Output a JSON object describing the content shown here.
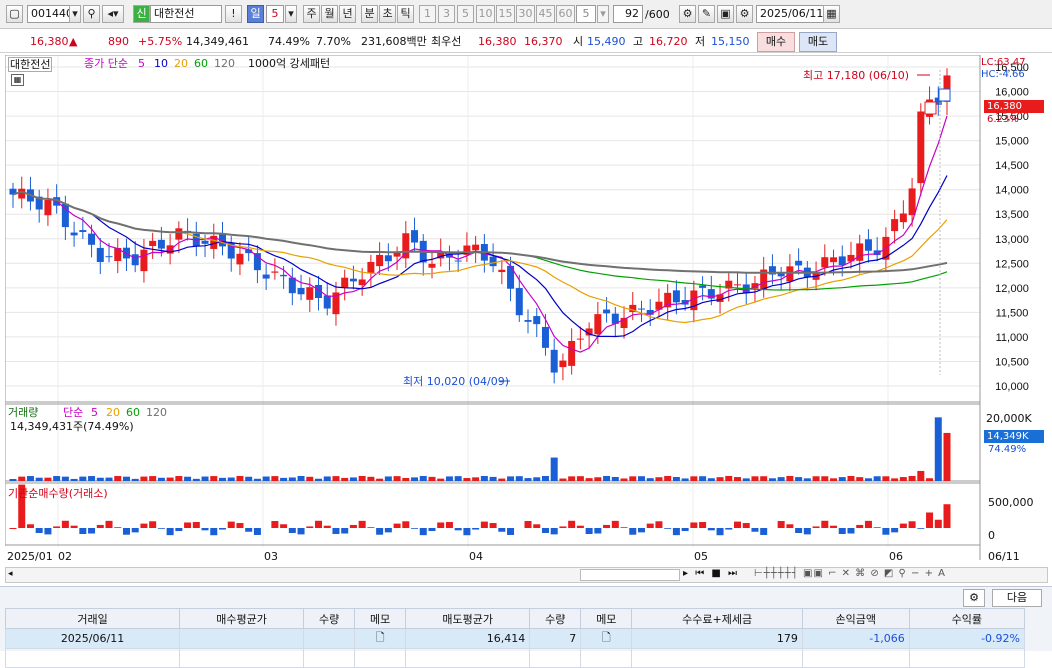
{
  "toolbar": {
    "stock_code": "001440",
    "stock_badge": "신",
    "stock_name": "대한전선",
    "period_labels": [
      "일",
      "5"
    ],
    "period_options": [
      "주",
      "월",
      "년",
      "분",
      "초",
      "틱"
    ],
    "interval_options": [
      "1",
      "3",
      "5",
      "10",
      "15",
      "30",
      "45",
      "60"
    ],
    "interval_value": "5",
    "count_value": "92",
    "count_total": "/600",
    "date": "2025/06/11"
  },
  "quote": {
    "price": "16,380",
    "arrow": "▲",
    "change": "890",
    "change_pct": "+5.75%",
    "volume": "14,349,461",
    "volume_ratio": "74.49%",
    "turnover": "7.70%",
    "amount": "231,608백만",
    "best_label": "최우선",
    "bid": "16,380",
    "ask": "16,370",
    "open_label": "시",
    "open": "15,490",
    "high_label": "고",
    "high": "16,720",
    "low_label": "저",
    "low": "15,150",
    "buy_btn": "매수",
    "sell_btn": "매도"
  },
  "price_panel": {
    "title": "대한전선",
    "legend_prefix": "종가 단순",
    "ma_labels": [
      "5",
      "10",
      "20",
      "60",
      "120"
    ],
    "ma_colors": [
      "#c800c8",
      "#0000c8",
      "#e6a000",
      "#00a000",
      "#707070"
    ],
    "extra": "1000억 강세패턴",
    "lc": "LC:63.47",
    "hc": "HC:-4.66",
    "high_annot": "최고 17,180 (06/10)",
    "low_annot": "최저 10,020 (04/09)",
    "last_price": "16,380",
    "last_pct": "6.23%",
    "axis_top": "16,500"
  },
  "volume_panel": {
    "title": "거래량",
    "legend_prefix": "단순",
    "ma_labels": [
      "5",
      "20",
      "60",
      "120"
    ],
    "info": "14,349,431주(74.49%)",
    "axis_top": "20,000K",
    "last": "14,349K",
    "last_pct": "74.49%"
  },
  "inst_panel": {
    "title": "기관순매수량(거래소)",
    "axis_ticks": [
      "500,000",
      "0"
    ]
  },
  "xaxis": {
    "labels": [
      "2025/01",
      "02",
      "03",
      "04",
      "05",
      "06",
      "06/11"
    ]
  },
  "chart_data": {
    "type": "candlestick",
    "xlabel": "",
    "ylabel": "",
    "ylim": [
      10000,
      16500
    ],
    "y_ticks": [
      "16,500",
      "16,000",
      "15,500",
      "15,000",
      "14,500",
      "14,000",
      "13,500",
      "13,000",
      "12,500",
      "12,000",
      "11,500",
      "11,000",
      "10,500",
      "10,000"
    ],
    "volume_ylim_k": [
      0,
      20000
    ],
    "inst_ylim": [
      -100000,
      500000
    ]
  },
  "table": {
    "headers": [
      "거래일",
      "매수평균가",
      "수량",
      "메모",
      "매도평균가",
      "수량",
      "메모",
      "수수료+제세금",
      "손익금액",
      "수익률"
    ],
    "rows": [
      [
        "2025/06/11",
        "",
        "",
        "",
        "16,414",
        "7",
        "",
        "179",
        "-1,066",
        "-0.92%"
      ]
    ]
  },
  "colors": {
    "up": "#d0021b",
    "down": "#1a4fd6",
    "accent": "#5b7fd6"
  },
  "footer_btn": "다음"
}
